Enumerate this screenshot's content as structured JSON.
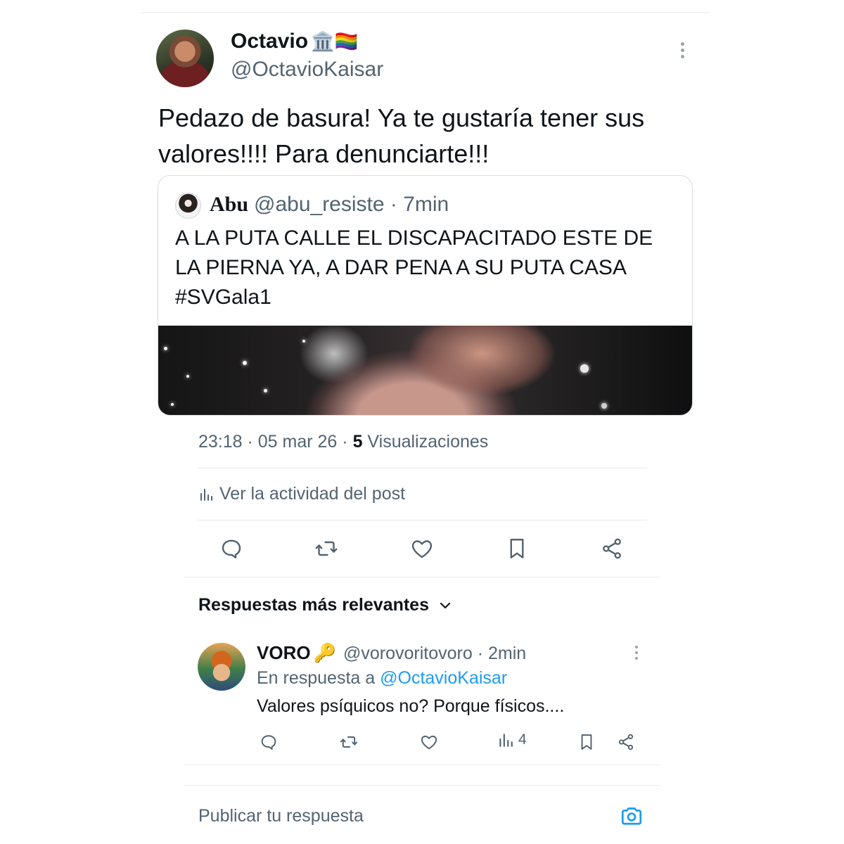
{
  "post": {
    "author_name": "Octavio",
    "author_emojis": "🏛️🏳️‍🌈",
    "author_handle": "@OctavioKaisar",
    "text": "Pedazo de basura! Ya te gustaría tener sus valores!!!! Para denunciarte!!!",
    "quote": {
      "author_name": "Abu",
      "author_meta": "@abu_resiste · 7min",
      "text": "A LA PUTA CALLE EL DISCAPACITADO ESTE DE LA PIERNA YA, A DAR PENA A SU PUTA CASA #SVGala1"
    },
    "timestamp": "23:18 · 05 mar 26 · ",
    "views_count": "5",
    "views_label": " Visualizaciones",
    "activity_label": "Ver la actividad del post"
  },
  "actions": {
    "icons": [
      "reply-icon",
      "repost-icon",
      "like-icon",
      "bookmark-icon",
      "share-icon"
    ]
  },
  "replies": {
    "sort_label": "Respuestas más relevantes",
    "items": [
      {
        "author_name": "VORO",
        "author_emoji": "🔑",
        "author_meta": "@vorovoritovoro · 2min",
        "in_reply_prefix": "En respuesta a ",
        "in_reply_mention": "@OctavioKaisar",
        "text": "Valores psíquicos no? Porque físicos....",
        "views": "4"
      }
    ]
  },
  "composer": {
    "placeholder": "Publicar tu respuesta"
  },
  "colors": {
    "text_primary": "#0f1419",
    "text_secondary": "#536471",
    "accent": "#1d9bf0",
    "divider": "#e6e9eb"
  }
}
